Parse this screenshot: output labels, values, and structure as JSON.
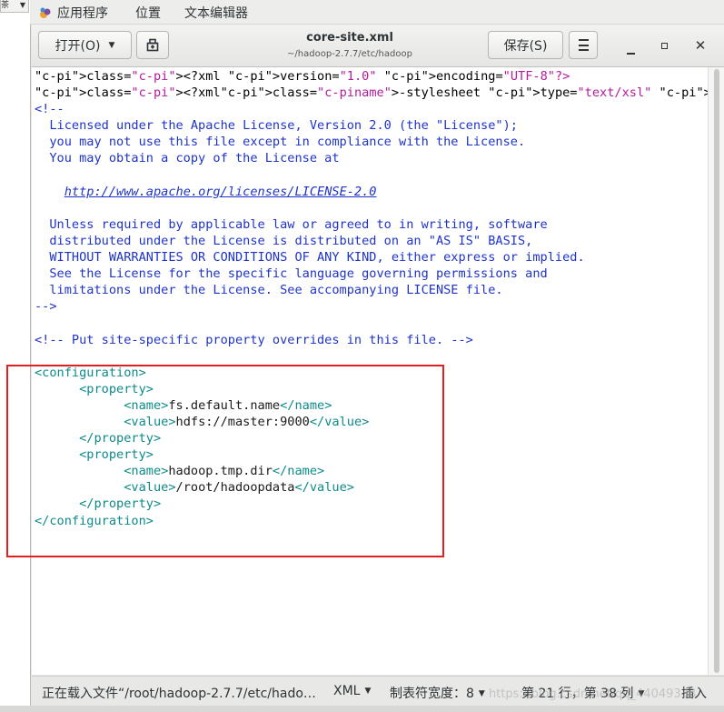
{
  "left_window": {
    "combo_text": "茶"
  },
  "top_panel": {
    "applications": "应用程序",
    "places": "位置",
    "active_app": "文本编辑器"
  },
  "header": {
    "open_label": "打开(O)",
    "title": "core-site.xml",
    "subtitle": "~/hadoop-2.7.7/etc/hadoop",
    "save_label": "保存(S)"
  },
  "code_lines": [
    [
      "<?xml version=\"1.0\" encoding=\"UTF-8\"?>"
    ],
    [
      "<?xml-stylesheet type=\"text/xsl\" href=\"configuration.xsl\"?>"
    ],
    [
      "<!--"
    ],
    [
      "  Licensed under the Apache License, Version 2.0 (the \"License\");"
    ],
    [
      "  you may not use this file except in compliance with the License."
    ],
    [
      "  You may obtain a copy of the License at"
    ],
    [
      ""
    ],
    [
      "    http://www.apache.org/licenses/LICENSE-2.0"
    ],
    [
      ""
    ],
    [
      "  Unless required by applicable law or agreed to in writing, software"
    ],
    [
      "  distributed under the License is distributed on an \"AS IS\" BASIS,"
    ],
    [
      "  WITHOUT WARRANTIES OR CONDITIONS OF ANY KIND, either express or implied."
    ],
    [
      "  See the License for the specific language governing permissions and"
    ],
    [
      "  limitations under the License. See accompanying LICENSE file."
    ],
    [
      "-->"
    ],
    [
      ""
    ],
    [
      "<!-- Put site-specific property overrides in this file. -->"
    ],
    [
      ""
    ],
    [
      "<configuration>"
    ],
    [
      "\t<property>"
    ],
    [
      "\t\t<name>fs.default.name</name>"
    ],
    [
      "\t\t<value>hdfs://master:9000</value>"
    ],
    [
      "\t</property>"
    ],
    [
      "\t<property>"
    ],
    [
      "\t\t<name>hadoop.tmp.dir</name>"
    ],
    [
      "\t\t<value>/root/hadoopdata</value>"
    ],
    [
      "\t</property>"
    ],
    [
      "</configuration>"
    ]
  ],
  "status_bar": {
    "loading": "正在载入文件“/root/hadoop-2.7.7/etc/hado…",
    "language": "XML",
    "tab_width": "制表符宽度：8",
    "position": "第 21 行，第 38 列",
    "mode": "插入"
  },
  "watermark": "https://blog.csdn.net/qq_44049333",
  "colors": {
    "processing_instruction": "#b41c9b",
    "comment": "#1e33c8",
    "tag": "#0d8a8a",
    "annotation_box": "#e02020"
  }
}
